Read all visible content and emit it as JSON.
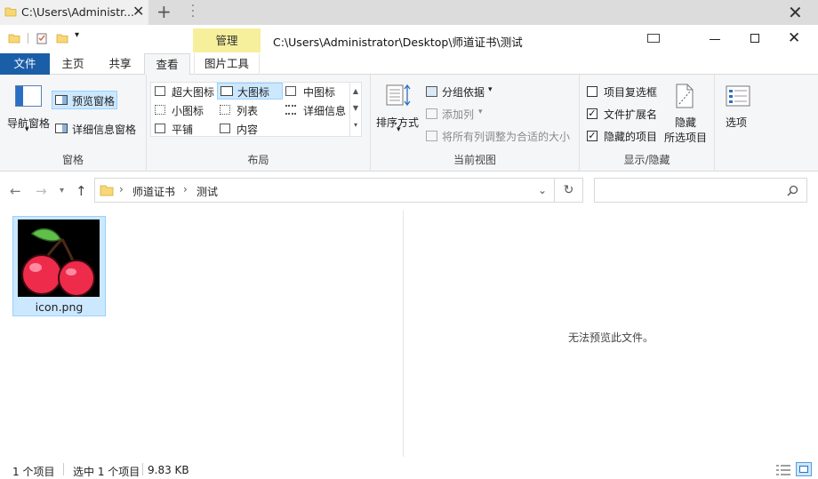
{
  "tab": {
    "title": "C:\\Users\\Administr...",
    "close": "✕",
    "new": "+"
  },
  "window": {
    "path_title": "C:\\Users\\Administrator\\Desktop\\师道证书\\测试",
    "close": "✕"
  },
  "context_tab": {
    "label": "管理"
  },
  "ribbon_tabs": {
    "file": "文件",
    "home": "主页",
    "share": "共享",
    "view": "查看",
    "picture_tools": "图片工具"
  },
  "ribbon": {
    "panes": {
      "nav_pane": "导航窗格",
      "preview_pane": "预览窗格",
      "details_pane": "详细信息窗格",
      "group_label": "窗格"
    },
    "layout": {
      "extra_large": "超大图标",
      "large": "大图标",
      "medium": "中图标",
      "small": "小图标",
      "list": "列表",
      "details": "详细信息",
      "tiles": "平铺",
      "content": "内容",
      "group_label": "布局"
    },
    "current_view": {
      "sort_by": "排序方式",
      "group_by": "分组依据",
      "add_columns": "添加列",
      "size_all_columns": "将所有列调整为合适的大小",
      "group_label": "当前视图"
    },
    "show_hide": {
      "item_checkboxes": "项目复选框",
      "item_checkboxes_checked": false,
      "file_extensions": "文件扩展名",
      "file_extensions_checked": true,
      "hidden_items": "隐藏的项目",
      "hidden_items_checked": true,
      "hide_selected_1": "隐藏",
      "hide_selected_2": "所选项目",
      "group_label": "显示/隐藏"
    },
    "options": "选项"
  },
  "address": {
    "crumbs": [
      "师道证书",
      "测试"
    ],
    "sep": "›"
  },
  "files": [
    {
      "name": "icon.png",
      "selected": true
    }
  ],
  "preview": {
    "message": "无法预览此文件。"
  },
  "status": {
    "count": "1 个项目",
    "selected": "选中 1 个项目",
    "size": "9.83 KB"
  },
  "colors": {
    "file_tab": "#1a5ea8",
    "selection": "#cce8ff",
    "manage_tab": "#f6ef9c"
  }
}
